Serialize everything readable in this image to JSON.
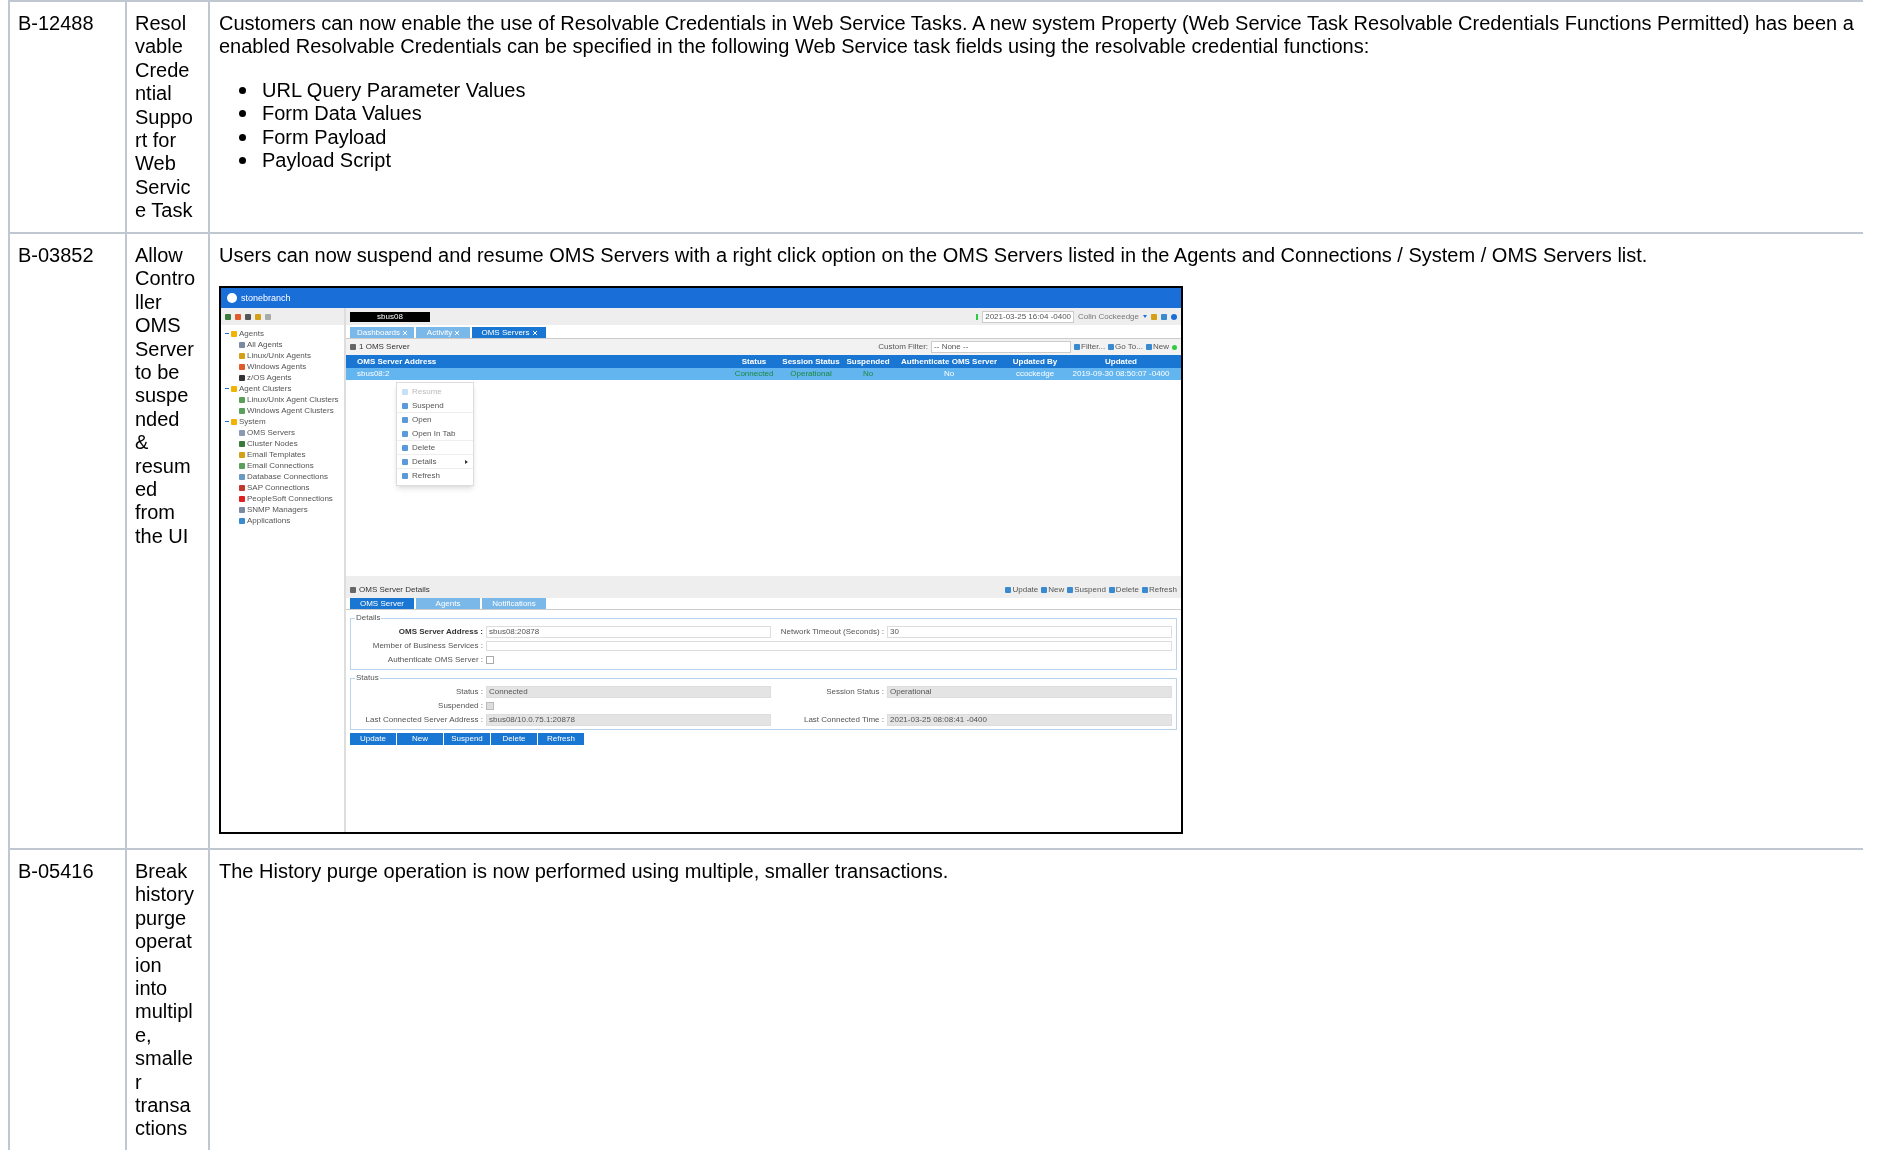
{
  "rows": [
    {
      "id": "B-12488",
      "summary": "Resolvable Credential Support for Web Service Task",
      "description": {
        "lines": [
          "Customers can now enable the use of Resolvable Credentials in Web Service Tasks. A new system Property (Web Service Task Resolvable Credentials Functions Permitted) has been a",
          "enabled Resolvable Credentials can be specified in the following Web Service task fields using the resolvable credential functions:"
        ],
        "bullets": [
          "URL Query Parameter Values",
          "Form Data Values",
          "Form Payload",
          "Payload Script"
        ]
      }
    },
    {
      "id": "B-03852",
      "summary": "Allow Controller OMS Server to be suspended & resumed from the UI",
      "description": {
        "lines": [
          "Users can now suspend and resume OMS Servers with a right click option on the OMS Servers listed in the Agents and Connections / System / OMS Servers list."
        ],
        "screenshot": {
          "brand": "stonebranch",
          "instance": "sbus08",
          "clock": "2021-03-25 16:04 -0400",
          "user": "Colin Cockeedge",
          "nav_tree": [
            {
              "label": "Agents",
              "expanded": true,
              "children": [
                {
                  "label": "All Agents",
                  "color": "#7a8aa0"
                },
                {
                  "label": "Linux/Unix Agents",
                  "color": "#d4a017"
                },
                {
                  "label": "Windows Agents",
                  "color": "#e05a2b"
                },
                {
                  "label": "z/OS Agents",
                  "color": "#333333"
                }
              ]
            },
            {
              "label": "Agent Clusters",
              "expanded": true,
              "children": [
                {
                  "label": "Linux/Unix Agent Clusters",
                  "color": "#5aa05a"
                },
                {
                  "label": "Windows Agent Clusters",
                  "color": "#5aa05a"
                }
              ]
            },
            {
              "label": "System",
              "expanded": true,
              "children": [
                {
                  "label": "OMS Servers",
                  "color": "#8a9ab0"
                },
                {
                  "label": "Cluster Nodes",
                  "color": "#3a7a3a"
                },
                {
                  "label": "Email Templates",
                  "color": "#d4a017"
                },
                {
                  "label": "Email Connections",
                  "color": "#5aa05a"
                },
                {
                  "label": "Database Connections",
                  "color": "#6a9ac0"
                },
                {
                  "label": "SAP Connections",
                  "color": "#c0392b"
                },
                {
                  "label": "PeopleSoft Connections",
                  "color": "#e02020"
                },
                {
                  "label": "SNMP Managers",
                  "color": "#7a8aa0"
                },
                {
                  "label": "Applications",
                  "color": "#3a8ad0"
                }
              ]
            }
          ],
          "tabs": [
            {
              "label": "Dashboards",
              "selected": false
            },
            {
              "label": "Activity",
              "selected": false
            },
            {
              "label": "OMS Servers",
              "selected": true
            }
          ],
          "list_title": "1 OMS Server",
          "filter_label": "Custom Filter:",
          "filter_value": "-- None --",
          "list_actions": [
            "Filter...",
            "Go To...",
            "New"
          ],
          "columns": [
            "OMS Server Address",
            "Status",
            "Session Status",
            "Suspended",
            "Authenticate OMS Server",
            "Updated By",
            "Updated"
          ],
          "grid_rows": [
            {
              "selected": true,
              "cells": [
                "sbus08:2",
                "Connected",
                "Operational",
                "No",
                "No",
                "ccockedge",
                "2019-09-30 08:50:07 -0400"
              ]
            }
          ],
          "context_menu": [
            {
              "label": "Resume",
              "disabled": true,
              "submenu": false
            },
            {
              "label": "Suspend",
              "disabled": false,
              "submenu": false
            },
            {
              "label": "Open",
              "disabled": false,
              "submenu": false
            },
            {
              "label": "Open In Tab",
              "disabled": false,
              "submenu": false
            },
            {
              "label": "Delete",
              "disabled": false,
              "submenu": false
            },
            {
              "label": "Details",
              "disabled": false,
              "submenu": true
            },
            {
              "label": "Refresh",
              "disabled": false,
              "submenu": false
            }
          ],
          "details_title": "OMS Server Details",
          "details_actions": [
            "Update",
            "New",
            "Suspend",
            "Delete",
            "Refresh"
          ],
          "details_tabs": [
            {
              "label": "OMS Server",
              "selected": true
            },
            {
              "label": "Agents",
              "selected": false
            },
            {
              "label": "Notifications",
              "selected": false
            }
          ],
          "sections": [
            {
              "legend": "Details",
              "fields": [
                {
                  "kind": "text",
                  "label": "OMS Server Address :",
                  "value": "sbus08:20878",
                  "label2": "Network Timeout (Seconds) :",
                  "value2": "30",
                  "bold": true
                },
                {
                  "kind": "select",
                  "label": "Member of Business Services :"
                },
                {
                  "kind": "checkbox",
                  "label": "Authenticate OMS Server :",
                  "checked": false,
                  "disabled": false
                }
              ]
            },
            {
              "legend": "Status",
              "fields": [
                {
                  "kind": "text",
                  "label": "Status :",
                  "value": "Connected",
                  "label2": "Session Status :",
                  "value2": "Operational",
                  "bold": false
                },
                {
                  "kind": "checkbox",
                  "label": "Suspended :",
                  "checked": false,
                  "disabled": true
                },
                {
                  "kind": "text",
                  "label": "Last Connected Server Address :",
                  "value": "sbus08/10.0.75.1:20878",
                  "label2": "Last Connected Time :",
                  "value2": "2021-03-25 08:08:41 -0400",
                  "bold": false
                }
              ]
            }
          ],
          "buttons": [
            "Update",
            "New",
            "Suspend",
            "Delete",
            "Refresh"
          ]
        }
      }
    },
    {
      "id": "B-05416",
      "summary": "Break history purge operation into multiple, smaller transactions",
      "description": {
        "lines": [
          "The History purge operation is now performed using multiple, smaller transactions."
        ]
      }
    }
  ]
}
